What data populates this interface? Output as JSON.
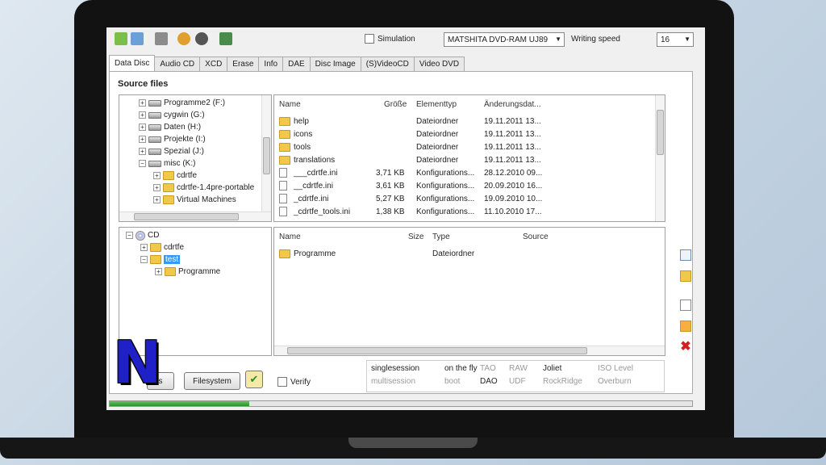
{
  "toolbar": {
    "simulation_label": "Simulation",
    "drive": "MATSHITA DVD-RAM UJ89",
    "writing_speed_label": "Writing speed",
    "writing_speed_value": "16"
  },
  "tabs": [
    "Data Disc",
    "Audio CD",
    "XCD",
    "Erase",
    "Info",
    "DAE",
    "Disc Image",
    "(S)VideoCD",
    "Video DVD"
  ],
  "active_tab": "Data Disc",
  "source_title": "Source files",
  "source_tree": [
    {
      "label": "Programme2 (F:)",
      "type": "drive",
      "level": 0
    },
    {
      "label": "cygwin (G:)",
      "type": "drive",
      "level": 0
    },
    {
      "label": "Daten (H:)",
      "type": "drive",
      "level": 0
    },
    {
      "label": "Projekte (I:)",
      "type": "drive",
      "level": 0
    },
    {
      "label": "Spezial (J:)",
      "type": "drive",
      "level": 0
    },
    {
      "label": "misc (K:)",
      "type": "drive",
      "level": 0
    },
    {
      "label": "cdrtfe",
      "type": "folder",
      "level": 1
    },
    {
      "label": "cdrtfe-1.4pre-portable",
      "type": "folder",
      "level": 1
    },
    {
      "label": "Virtual Machines",
      "type": "folder",
      "level": 1
    }
  ],
  "source_columns": [
    "Name",
    "Größe",
    "Elementtyp",
    "Änderungsdat..."
  ],
  "source_files": [
    {
      "name": "help",
      "size": "",
      "type": "Dateiordner",
      "date": "19.11.2011 13...",
      "kind": "folder"
    },
    {
      "name": "icons",
      "size": "",
      "type": "Dateiordner",
      "date": "19.11.2011 13...",
      "kind": "folder"
    },
    {
      "name": "tools",
      "size": "",
      "type": "Dateiordner",
      "date": "19.11.2011 13...",
      "kind": "folder"
    },
    {
      "name": "translations",
      "size": "",
      "type": "Dateiordner",
      "date": "19.11.2011 13...",
      "kind": "folder"
    },
    {
      "name": "___cdrtfe.ini",
      "size": "3,71 KB",
      "type": "Konfigurations...",
      "date": "28.12.2010 09...",
      "kind": "file"
    },
    {
      "name": "__cdrtfe.ini",
      "size": "3,61 KB",
      "type": "Konfigurations...",
      "date": "20.09.2010 16...",
      "kind": "file"
    },
    {
      "name": "_cdrtfe.ini",
      "size": "5,27 KB",
      "type": "Konfigurations...",
      "date": "19.09.2010 10...",
      "kind": "file"
    },
    {
      "name": "_cdrtfe_tools.ini",
      "size": "1,38 KB",
      "type": "Konfigurations...",
      "date": "11.10.2010 17...",
      "kind": "file"
    }
  ],
  "cd_tree": [
    {
      "label": "CD",
      "type": "cd",
      "level": 0
    },
    {
      "label": "cdrtfe",
      "type": "folder",
      "level": 1
    },
    {
      "label": "test",
      "type": "folder",
      "level": 1,
      "selected": true
    },
    {
      "label": "Programme",
      "type": "folder",
      "level": 2
    }
  ],
  "cd_columns": [
    "Name",
    "Size",
    "Type",
    "Source"
  ],
  "cd_files": [
    {
      "name": "Programme",
      "size": "",
      "type": "Dateiordner",
      "source": ""
    }
  ],
  "bottom": {
    "options_button_partial": "s",
    "filesystem_button": "Filesystem",
    "verify_label": "Verify"
  },
  "options": [
    {
      "label": "singlesession",
      "on": true
    },
    {
      "label": "on the fly",
      "on": true
    },
    {
      "label": "TAO",
      "on": false
    },
    {
      "label": "RAW",
      "on": false
    },
    {
      "label": "Joliet",
      "on": true
    },
    {
      "label": "ISO Level",
      "on": false
    },
    {
      "label": "multisession",
      "on": false
    },
    {
      "label": "boot",
      "on": false
    },
    {
      "label": "DAO",
      "on": true
    },
    {
      "label": "UDF",
      "on": false
    },
    {
      "label": "RockRidge",
      "on": false
    },
    {
      "label": "Overburn",
      "on": false
    }
  ],
  "progress": 0.24,
  "watermark": "N",
  "colors": {
    "accent": "#3399ff",
    "watermark": "#2020c8",
    "progress": "#2e8f2e"
  }
}
